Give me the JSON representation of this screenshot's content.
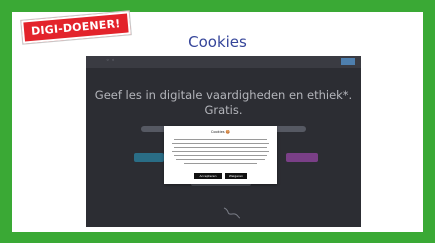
{
  "badge": {
    "label": "DIGI-DOENER!"
  },
  "title": "Cookies",
  "screenshot": {
    "hero_text": "Geef les in digitale vaardigheden en ethiek*. Gratis.",
    "cookie_dialog": {
      "title": "Cookies 🍪",
      "accept_label": "Accepteren",
      "decline_label": "Weigeren"
    }
  },
  "colors": {
    "frame": "#3aa935",
    "badge": "#e3232b",
    "title": "#35459a",
    "screen_bg": "#2c2d33"
  }
}
